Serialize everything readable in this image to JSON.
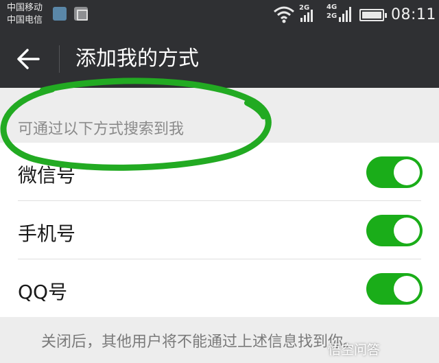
{
  "status_bar": {
    "carrier_1": "中国移动",
    "carrier_2": "中国电信",
    "network_1": "2G",
    "network_2_top": "4G",
    "network_2_bottom": "2G",
    "time": "08:11",
    "icons": [
      "app-notification-icon",
      "gallery-notification-icon",
      "wifi-icon",
      "signal-icon",
      "battery-icon"
    ]
  },
  "header": {
    "title": "添加我的方式",
    "back_icon": "back-arrow-icon"
  },
  "section": {
    "label": "可通过以下方式搜索到我"
  },
  "options": [
    {
      "label": "微信号",
      "enabled": true
    },
    {
      "label": "手机号",
      "enabled": true
    },
    {
      "label": "QQ号",
      "enabled": true
    }
  ],
  "footer": {
    "hint": "关闭后，其他用户将不能通过上述信息找到你。"
  },
  "watermark": {
    "text": "悟空问答"
  },
  "colors": {
    "bar_background": "#2f3033",
    "toggle_on": "#1aad19",
    "page_background": "#ededed",
    "annotation": "#22aa22"
  }
}
